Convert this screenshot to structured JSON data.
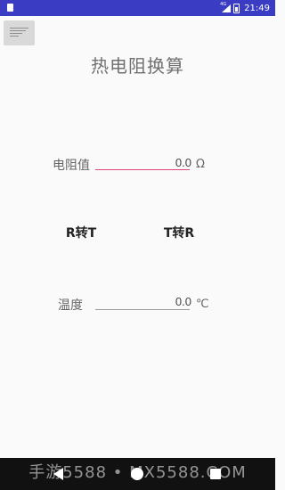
{
  "status_bar": {
    "network": "4G",
    "time": "21:49",
    "icons": [
      "sd-card-icon",
      "signal-icon",
      "battery-icon"
    ]
  },
  "menu": {
    "icon": "filter-list-icon"
  },
  "title": "热电阻换算",
  "resistance": {
    "label": "电阻值",
    "value": "0.0",
    "unit": "Ω",
    "underline_color": "#e0457b"
  },
  "temperature": {
    "label": "温度",
    "value": "0.0",
    "unit": "℃",
    "underline_color": "#9e9e9e"
  },
  "buttons": {
    "r_to_t": "R转T",
    "t_to_r": "T转R"
  },
  "navigation": {
    "icons": [
      "back-icon",
      "home-icon",
      "recent-apps-icon"
    ]
  },
  "watermark": "手游5588 • MX5588.COM",
  "colors": {
    "status_bar": "#3a3dc4",
    "accent": "#e0457b",
    "background": "#fafafa"
  }
}
